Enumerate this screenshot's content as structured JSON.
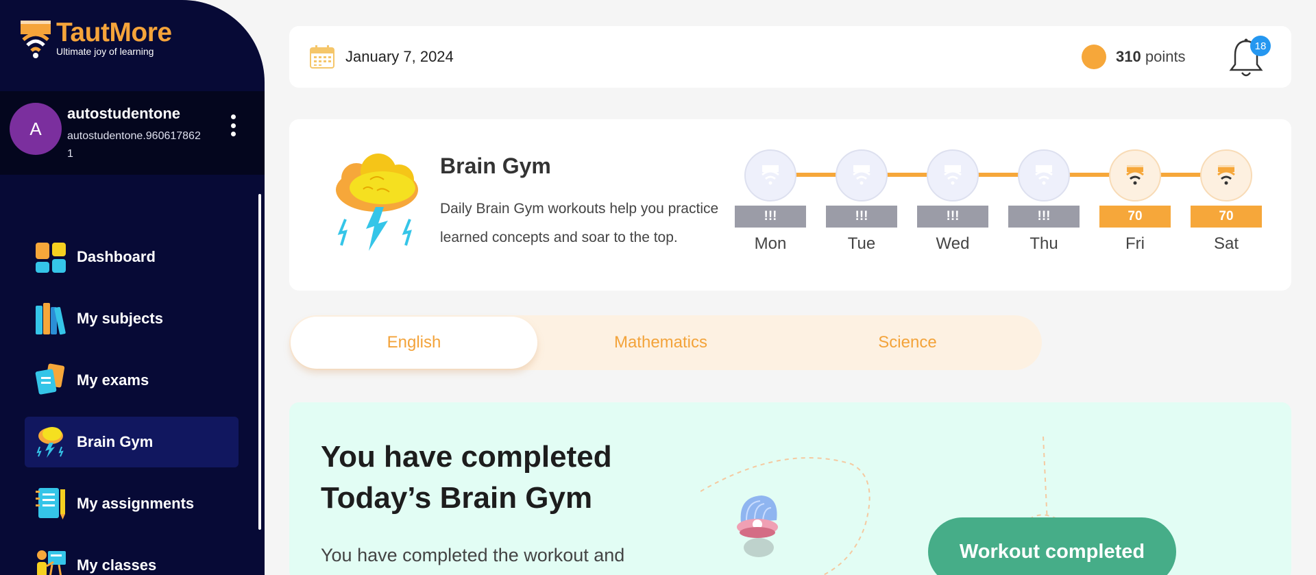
{
  "brand": {
    "name": "TautMore",
    "tagline": "Ultimate joy of learning",
    "color": "#f5a43a"
  },
  "user": {
    "avatar_letter": "A",
    "name": "autostudentone",
    "email": "autostudentone.9606178621"
  },
  "nav": {
    "items": [
      {
        "label": "Dashboard",
        "icon": "dashboard-icon",
        "active": false
      },
      {
        "label": "My subjects",
        "icon": "books-icon",
        "active": false
      },
      {
        "label": "My exams",
        "icon": "exam-cards-icon",
        "active": false
      },
      {
        "label": "Brain Gym",
        "icon": "brain-cloud-icon",
        "active": true
      },
      {
        "label": "My assignments",
        "icon": "notebook-icon",
        "active": false
      },
      {
        "label": "My classes",
        "icon": "classroom-icon",
        "active": false
      }
    ]
  },
  "header": {
    "date": "January 7, 2024",
    "points_value": "310",
    "points_unit": "points",
    "notifications": "18"
  },
  "brain_gym": {
    "title": "Brain Gym",
    "description": "Daily Brain Gym workouts help you practice learned concepts and soar to the top.",
    "days": [
      {
        "label": "Mon",
        "score": "!!!",
        "status": "missed"
      },
      {
        "label": "Tue",
        "score": "!!!",
        "status": "missed"
      },
      {
        "label": "Wed",
        "score": "!!!",
        "status": "missed"
      },
      {
        "label": "Thu",
        "score": "!!!",
        "status": "missed"
      },
      {
        "label": "Fri",
        "score": "70",
        "status": "completed"
      },
      {
        "label": "Sat",
        "score": "70",
        "status": "completed"
      }
    ]
  },
  "tabs": [
    {
      "label": "English",
      "active": true
    },
    {
      "label": "Mathematics",
      "active": false
    },
    {
      "label": "Science",
      "active": false
    }
  ],
  "completion": {
    "title_line1": "You have completed",
    "title_line2": "Today’s Brain Gym",
    "message": "You have completed the workout and",
    "button_label": "Workout completed"
  },
  "colors": {
    "sidebar_bg": "#070a36",
    "accent_orange": "#f6a73a",
    "success_green": "#46ad88",
    "badge_blue": "#2597f0"
  }
}
